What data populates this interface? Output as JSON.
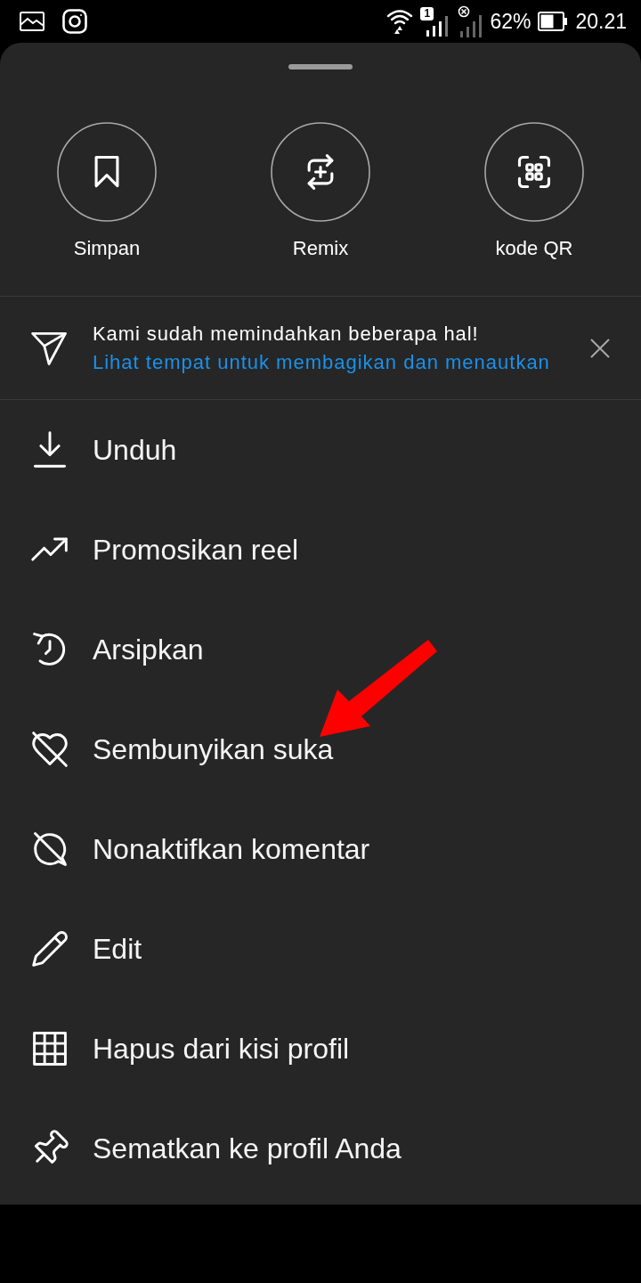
{
  "status_bar": {
    "sim_badge": "1",
    "battery": "62%",
    "time": "20.21"
  },
  "sheet": {
    "actions": [
      {
        "label": "Simpan"
      },
      {
        "label": "Remix"
      },
      {
        "label": "kode QR"
      }
    ],
    "notice": {
      "title": "Kami sudah memindahkan beberapa hal!",
      "link": "Lihat tempat untuk membagikan dan menautkan"
    },
    "menu": [
      {
        "label": "Unduh"
      },
      {
        "label": "Promosikan reel"
      },
      {
        "label": "Arsipkan"
      },
      {
        "label": "Sembunyikan suka"
      },
      {
        "label": "Nonaktifkan komentar"
      },
      {
        "label": "Edit"
      },
      {
        "label": "Hapus dari kisi profil"
      },
      {
        "label": "Sematkan ke profil Anda"
      }
    ]
  },
  "annotations": [
    {
      "kind": "arrow"
    }
  ]
}
